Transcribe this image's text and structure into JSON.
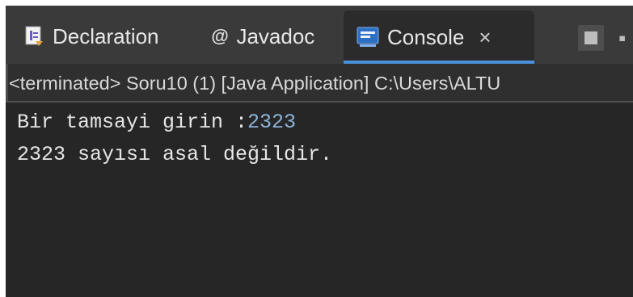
{
  "tabs": {
    "declaration": {
      "label": "Declaration",
      "icon": "declaration-icon"
    },
    "javadoc": {
      "label": "Javadoc",
      "icon": "at-icon",
      "icon_glyph": "@"
    },
    "console": {
      "label": "Console",
      "icon": "console-icon",
      "close_glyph": "×",
      "active": true
    }
  },
  "status_line": "<terminated> Soru10 (1) [Java Application] C:\\Users\\ALTU",
  "console": {
    "line1_prompt": "Bir tamsayi girin :",
    "line1_input": "2323",
    "line2": "2323 sayısı asal değildir."
  },
  "colors": {
    "accent": "#4a90d9",
    "background": "#2f2f2f",
    "console_bg": "#262626",
    "input_text": "#8db4d8"
  }
}
